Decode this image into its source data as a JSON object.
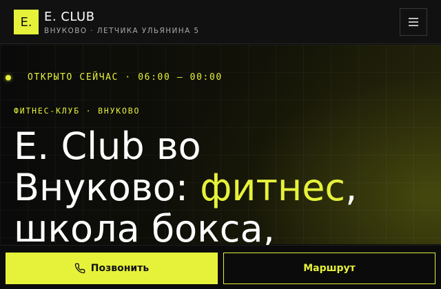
{
  "header": {
    "logo_text": "E.",
    "brand": "E. CLUB",
    "address": "ВНУКОВО · ЛЕТЧИКА УЛЬЯНИНА 5",
    "menu_icon": "menu-icon"
  },
  "hero": {
    "status": "ОТКРЫТО СЕЙЧАС · 06:00 — 00:00",
    "kicker": "ФИТНЕС-КЛУБ · ВНУКОВО",
    "headline": {
      "line1": "E. Club во",
      "line2_start": "Внуково: ",
      "line2_accent": "фитнес",
      "line2_end": ",",
      "line3": "школа бокса,"
    }
  },
  "actions": {
    "call_label": "Позвонить",
    "call_icon": "phone-icon",
    "route_label": "Маршрут"
  },
  "colors": {
    "accent": "#e6f23a",
    "background": "#0b0b0b",
    "text": "#ffffff"
  }
}
